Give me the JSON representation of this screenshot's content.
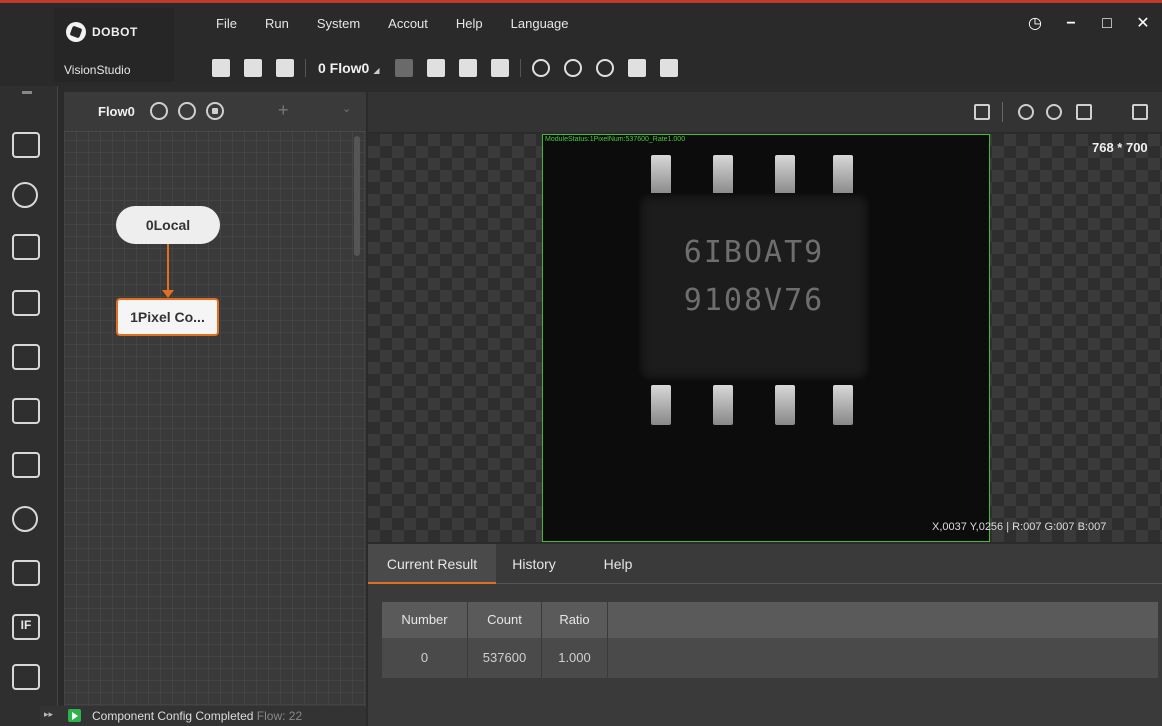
{
  "app": {
    "brand": "DOBOT",
    "product": "VisionStudio"
  },
  "menu": [
    "File",
    "Run",
    "System",
    "Accout",
    "Help",
    "Language"
  ],
  "window_controls": [
    "clock-icon",
    "minimize-icon",
    "maximize-icon",
    "close-icon"
  ],
  "toolbar": {
    "flow_select": "0 Flow0",
    "icons": [
      "add-module-icon",
      "save-icon",
      "open-folder-icon",
      "layers-icon",
      "network-icon",
      "var-icon",
      "camera-mode-icon",
      "run-once-icon",
      "run-loop-icon",
      "stop-icon",
      "format-icon",
      "undo-icon"
    ]
  },
  "sidebar": {
    "items": [
      "camera-icon",
      "locate-icon",
      "measure-icon",
      "align-icon",
      "recognition-icon",
      "calibration-icon",
      "image-process-icon",
      "color-icon",
      "defect-icon",
      "if-icon",
      "communication-icon"
    ],
    "if_label": "IF"
  },
  "flow": {
    "title": "Flow0",
    "nodes": [
      {
        "label": "0Local"
      },
      {
        "label": "1Pixel Co..."
      }
    ]
  },
  "status": {
    "message": "Component Config Completed",
    "flow_suffix": "Flow: 22"
  },
  "image": {
    "overlay_label": "ModuleStatus:1PixelNum:537600_Rate1.000",
    "dimensions": "768 * 700",
    "pixel_info": "X,0037  Y,0256 | R:007  G:007  B:007",
    "chip_line1": "6IBOAT9",
    "chip_line2": "9108V76"
  },
  "result": {
    "tabs": [
      "Current Result",
      "History",
      "Help"
    ],
    "active_tab": "Current Result",
    "columns": [
      "Number",
      "Count",
      "Ratio"
    ],
    "rows": [
      [
        "0",
        "537600",
        "1.000"
      ]
    ]
  },
  "colors": {
    "accent": "#e07020",
    "roi": "#47b83a",
    "topline": "#c0392b",
    "run": "#2db34a"
  }
}
